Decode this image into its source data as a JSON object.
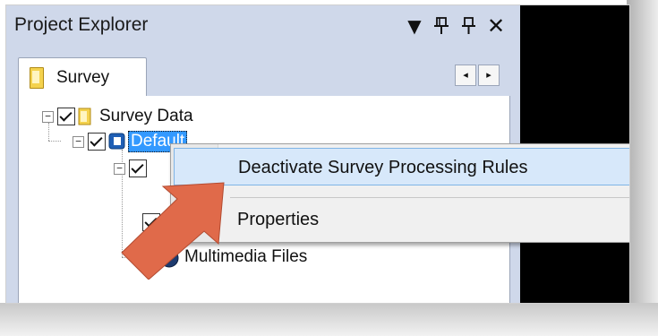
{
  "panel": {
    "title": "Project Explorer",
    "buttons": {
      "dropdown": "▼",
      "pin": "⸽",
      "autohide": "⊥",
      "close": "✕"
    }
  },
  "tabs": [
    {
      "label": "Survey",
      "icon": "folder-icon"
    }
  ],
  "tab_scroll": {
    "left": "◂",
    "right": "▸"
  },
  "tree": {
    "root": {
      "label": "Survey Data",
      "expanded": true,
      "checked": true
    },
    "default": {
      "label": "Default",
      "selected": true,
      "checked": true
    },
    "multimedia": {
      "label": "Multimedia Files",
      "checked": true
    }
  },
  "context_menu": {
    "items": [
      {
        "label": "Deactivate Survey Processing Rules",
        "highlighted": true
      },
      {
        "label": "Properties",
        "icon": "properties-icon"
      }
    ]
  },
  "colors": {
    "accent_selection": "#3399ff",
    "annotation_arrow": "#e06a4a",
    "title_bar": "#cfd8ea"
  }
}
